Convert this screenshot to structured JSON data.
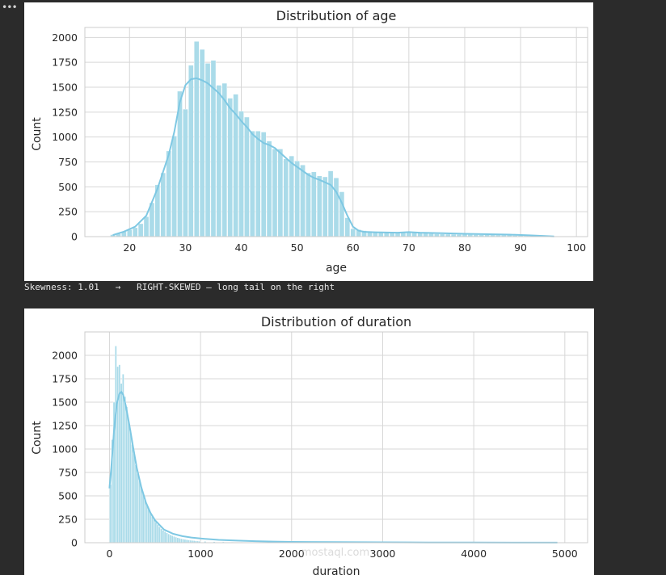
{
  "output_marker": "•••",
  "skewness_text": "Skewness: 1.01   →   RIGHT-SKEWED — long tail on the right",
  "watermark": "mostaql.com",
  "colors": {
    "bar_fill": "#aadbe9",
    "bar_edge": "#ffffff",
    "kde_line": "#7ec8e3",
    "grid": "#d7d7d7",
    "spine": "#cccccc"
  },
  "chart_data": [
    {
      "type": "bar",
      "title": "Distribution of age",
      "xlabel": "age",
      "ylabel": "Count",
      "xlim": [
        12,
        102
      ],
      "ylim": [
        0,
        2100
      ],
      "xticks": [
        20,
        30,
        40,
        50,
        60,
        70,
        80,
        90,
        100
      ],
      "yticks": [
        0,
        250,
        500,
        750,
        1000,
        1250,
        1500,
        1750,
        2000
      ],
      "grid": true,
      "bin_width": 0.88,
      "bars": [
        [
          17,
          20
        ],
        [
          18,
          30
        ],
        [
          19,
          50
        ],
        [
          20,
          70
        ],
        [
          21,
          90
        ],
        [
          22,
          130
        ],
        [
          23,
          200
        ],
        [
          24,
          340
        ],
        [
          25,
          520
        ],
        [
          26,
          640
        ],
        [
          27,
          860
        ],
        [
          28,
          1010
        ],
        [
          29,
          1460
        ],
        [
          30,
          1280
        ],
        [
          31,
          1720
        ],
        [
          32,
          1960
        ],
        [
          33,
          1880
        ],
        [
          34,
          1740
        ],
        [
          35,
          1770
        ],
        [
          36,
          1520
        ],
        [
          37,
          1540
        ],
        [
          38,
          1390
        ],
        [
          39,
          1430
        ],
        [
          40,
          1260
        ],
        [
          41,
          1200
        ],
        [
          42,
          1060
        ],
        [
          43,
          1060
        ],
        [
          44,
          1050
        ],
        [
          45,
          960
        ],
        [
          46,
          880
        ],
        [
          47,
          880
        ],
        [
          48,
          780
        ],
        [
          49,
          810
        ],
        [
          50,
          760
        ],
        [
          51,
          720
        ],
        [
          52,
          640
        ],
        [
          53,
          650
        ],
        [
          54,
          610
        ],
        [
          55,
          600
        ],
        [
          56,
          660
        ],
        [
          57,
          590
        ],
        [
          58,
          450
        ],
        [
          59,
          190
        ],
        [
          60,
          80
        ],
        [
          61,
          70
        ],
        [
          62,
          60
        ],
        [
          63,
          55
        ],
        [
          64,
          50
        ],
        [
          65,
          50
        ],
        [
          66,
          45
        ],
        [
          67,
          45
        ],
        [
          68,
          40
        ],
        [
          69,
          45
        ],
        [
          70,
          40
        ],
        [
          71,
          45
        ],
        [
          72,
          40
        ],
        [
          73,
          35
        ],
        [
          74,
          30
        ],
        [
          75,
          28
        ],
        [
          76,
          26
        ],
        [
          77,
          25
        ],
        [
          78,
          24
        ],
        [
          79,
          23
        ],
        [
          80,
          22
        ],
        [
          81,
          21
        ],
        [
          82,
          20
        ],
        [
          83,
          19
        ],
        [
          84,
          18
        ],
        [
          85,
          17
        ],
        [
          86,
          16
        ],
        [
          87,
          15
        ],
        [
          88,
          14
        ],
        [
          89,
          12
        ],
        [
          90,
          10
        ],
        [
          91,
          8
        ],
        [
          92,
          6
        ],
        [
          93,
          5
        ],
        [
          94,
          4
        ],
        [
          95,
          3
        ],
        [
          96,
          2
        ]
      ],
      "kde": [
        [
          17,
          15
        ],
        [
          19,
          50
        ],
        [
          21,
          100
        ],
        [
          23,
          210
        ],
        [
          25,
          480
        ],
        [
          27,
          820
        ],
        [
          28,
          1050
        ],
        [
          29,
          1350
        ],
        [
          30,
          1520
        ],
        [
          31,
          1580
        ],
        [
          32,
          1590
        ],
        [
          33,
          1570
        ],
        [
          34,
          1540
        ],
        [
          35,
          1490
        ],
        [
          36,
          1440
        ],
        [
          37,
          1370
        ],
        [
          38,
          1290
        ],
        [
          39,
          1230
        ],
        [
          40,
          1160
        ],
        [
          41,
          1100
        ],
        [
          42,
          1030
        ],
        [
          43,
          980
        ],
        [
          44,
          940
        ],
        [
          45,
          920
        ],
        [
          46,
          890
        ],
        [
          47,
          840
        ],
        [
          48,
          790
        ],
        [
          49,
          740
        ],
        [
          50,
          700
        ],
        [
          51,
          660
        ],
        [
          52,
          620
        ],
        [
          53,
          590
        ],
        [
          54,
          570
        ],
        [
          55,
          545
        ],
        [
          56,
          520
        ],
        [
          57,
          450
        ],
        [
          58,
          340
        ],
        [
          59,
          210
        ],
        [
          60,
          100
        ],
        [
          61,
          60
        ],
        [
          62,
          48
        ],
        [
          64,
          44
        ],
        [
          68,
          40
        ],
        [
          70,
          45
        ],
        [
          72,
          40
        ],
        [
          76,
          34
        ],
        [
          80,
          28
        ],
        [
          84,
          24
        ],
        [
          88,
          20
        ],
        [
          92,
          12
        ],
        [
          96,
          2
        ]
      ]
    },
    {
      "type": "bar",
      "title": "Distribution of duration",
      "xlabel": "duration",
      "ylabel": "Count",
      "xlim": [
        -270,
        5250
      ],
      "ylim": [
        0,
        2250
      ],
      "xticks": [
        0,
        1000,
        2000,
        3000,
        4000,
        5000
      ],
      "yticks": [
        0,
        250,
        500,
        750,
        1000,
        1250,
        1500,
        1750,
        2000
      ],
      "grid": true,
      "bin_width": 20,
      "bars": [
        [
          10,
          620
        ],
        [
          30,
          1100
        ],
        [
          50,
          1500
        ],
        [
          70,
          2100
        ],
        [
          90,
          1880
        ],
        [
          110,
          1900
        ],
        [
          130,
          1700
        ],
        [
          150,
          1800
        ],
        [
          170,
          1560
        ],
        [
          190,
          1450
        ],
        [
          210,
          1300
        ],
        [
          230,
          1200
        ],
        [
          250,
          1050
        ],
        [
          270,
          950
        ],
        [
          290,
          830
        ],
        [
          310,
          740
        ],
        [
          330,
          660
        ],
        [
          350,
          590
        ],
        [
          370,
          520
        ],
        [
          390,
          460
        ],
        [
          410,
          410
        ],
        [
          430,
          360
        ],
        [
          450,
          320
        ],
        [
          470,
          280
        ],
        [
          490,
          250
        ],
        [
          510,
          220
        ],
        [
          530,
          195
        ],
        [
          550,
          170
        ],
        [
          570,
          150
        ],
        [
          590,
          132
        ],
        [
          610,
          118
        ],
        [
          630,
          105
        ],
        [
          650,
          94
        ],
        [
          670,
          84
        ],
        [
          690,
          75
        ],
        [
          710,
          67
        ],
        [
          730,
          60
        ],
        [
          750,
          54
        ],
        [
          770,
          48
        ],
        [
          790,
          43
        ],
        [
          810,
          39
        ],
        [
          830,
          35
        ],
        [
          850,
          32
        ],
        [
          870,
          29
        ],
        [
          890,
          26
        ],
        [
          910,
          24
        ],
        [
          930,
          22
        ],
        [
          950,
          20
        ],
        [
          970,
          18
        ],
        [
          990,
          16
        ],
        [
          1050,
          14
        ],
        [
          1150,
          11
        ],
        [
          1250,
          9
        ],
        [
          1350,
          7
        ],
        [
          1450,
          6
        ],
        [
          1550,
          5
        ],
        [
          1650,
          4
        ],
        [
          1750,
          3
        ],
        [
          1850,
          3
        ],
        [
          1950,
          2
        ],
        [
          2100,
          2
        ],
        [
          2300,
          1
        ],
        [
          2600,
          1
        ],
        [
          3000,
          1
        ],
        [
          3400,
          1
        ],
        [
          3800,
          1
        ],
        [
          4200,
          1
        ],
        [
          4900,
          1
        ]
      ],
      "kde": [
        [
          0,
          580
        ],
        [
          20,
          800
        ],
        [
          50,
          1200
        ],
        [
          80,
          1480
        ],
        [
          110,
          1590
        ],
        [
          130,
          1610
        ],
        [
          150,
          1580
        ],
        [
          180,
          1460
        ],
        [
          220,
          1250
        ],
        [
          260,
          1020
        ],
        [
          300,
          800
        ],
        [
          350,
          590
        ],
        [
          400,
          430
        ],
        [
          450,
          320
        ],
        [
          500,
          240
        ],
        [
          600,
          140
        ],
        [
          700,
          95
        ],
        [
          800,
          70
        ],
        [
          900,
          55
        ],
        [
          1000,
          45
        ],
        [
          1200,
          30
        ],
        [
          1400,
          22
        ],
        [
          1600,
          16
        ],
        [
          1800,
          12
        ],
        [
          2000,
          9
        ],
        [
          2500,
          6
        ],
        [
          3000,
          4
        ],
        [
          3500,
          3
        ],
        [
          4000,
          2
        ],
        [
          4500,
          1
        ],
        [
          4918,
          1
        ]
      ]
    }
  ]
}
